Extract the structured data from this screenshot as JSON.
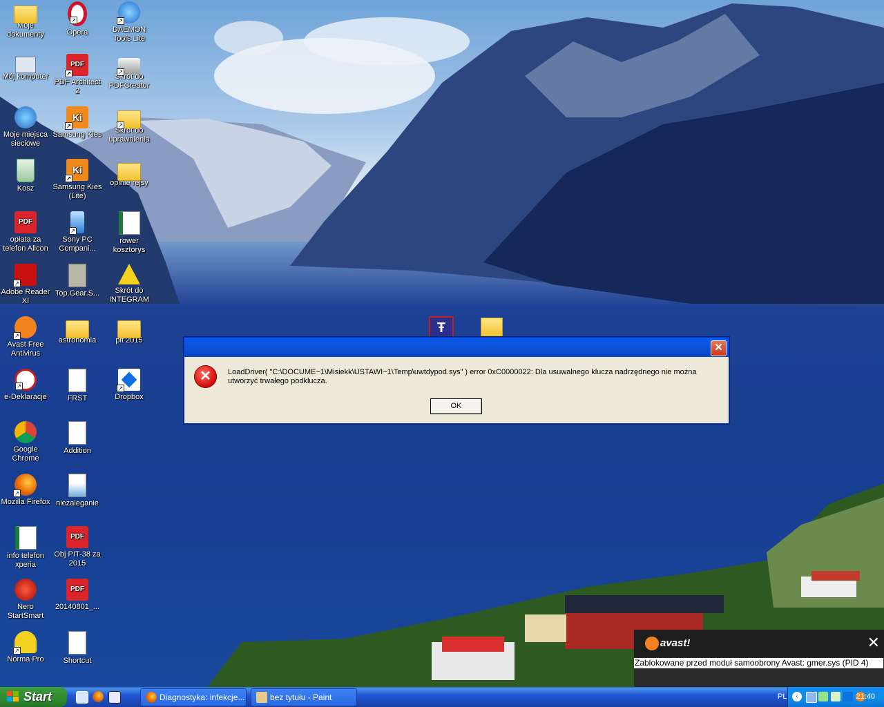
{
  "desktop": {
    "icons": [
      {
        "label": "Moje dokumenty",
        "icon": "my-documents-icon"
      },
      {
        "label": "Opera",
        "icon": "opera-icon"
      },
      {
        "label": "DAEMON Tools Lite",
        "icon": "daemon-tools-icon"
      },
      {
        "label": "Mój komputer",
        "icon": "my-computer-icon"
      },
      {
        "label": "PDF Architect 2",
        "icon": "pdf-architect-icon"
      },
      {
        "label": "Skrót do PDFCreator",
        "icon": "printer-icon"
      },
      {
        "label": "Moje miejsca sieciowe",
        "icon": "network-places-icon"
      },
      {
        "label": "Samsung Kies",
        "icon": "samsung-kies-icon"
      },
      {
        "label": "Skrót do uprawnienia",
        "icon": "folder-shortcut-icon"
      },
      {
        "label": "Kosz",
        "icon": "recycle-bin-icon"
      },
      {
        "label": "Samsung Kies (Lite)",
        "icon": "samsung-kies-lite-icon"
      },
      {
        "label": "opinie rejsy",
        "icon": "folder-icon"
      },
      {
        "label": "opłata za telefon Allcon",
        "icon": "pdf-file-icon"
      },
      {
        "label": "Sony PC Compani...",
        "icon": "sony-pc-companion-icon"
      },
      {
        "label": "rower kosztorys",
        "icon": "excel-file-icon"
      },
      {
        "label": "Adobe Reader XI",
        "icon": "adobe-reader-icon"
      },
      {
        "label": "Top.Gear.S...",
        "icon": "video-file-icon"
      },
      {
        "label": "Skrót do INTEGRAM",
        "icon": "integram-icon"
      },
      {
        "label": "Avast Free Antivirus",
        "icon": "avast-icon"
      },
      {
        "label": "astronomia",
        "icon": "folder-icon"
      },
      {
        "label": "pit 2015",
        "icon": "folder-icon"
      },
      {
        "label": "e-Deklaracje",
        "icon": "e-deklaracje-icon"
      },
      {
        "label": "FRST",
        "icon": "text-file-icon"
      },
      {
        "label": "Dropbox",
        "icon": "dropbox-icon"
      },
      {
        "label": "Google Chrome",
        "icon": "chrome-icon"
      },
      {
        "label": "Addition",
        "icon": "text-file-icon"
      },
      {
        "label": "Mozilla Firefox",
        "icon": "firefox-icon"
      },
      {
        "label": "niezaleganie",
        "icon": "image-file-icon"
      },
      {
        "label": "info telefon xperia",
        "icon": "excel-file-icon"
      },
      {
        "label": "Obj PIT-38 za 2015",
        "icon": "pdf-file-icon"
      },
      {
        "label": "Nero StartSmart",
        "icon": "nero-icon"
      },
      {
        "label": "20140801_...",
        "icon": "pdf-file-icon"
      },
      {
        "label": "Norma Pro",
        "icon": "norma-pro-icon"
      },
      {
        "label": "Shortcut",
        "icon": "text-file-icon"
      }
    ],
    "floating_icons": [
      "gmer-app-icon",
      "zip-folder-icon"
    ]
  },
  "dialog": {
    "title": "",
    "message": "LoadDriver( \"C:\\DOCUME~1\\Misiekk\\USTAWI~1\\Temp\\uwtdypod.sys\" ) error 0xC0000022: Dla usuwalnego klucza nadrzędnego nie można utworzyć trwałego podklucza.",
    "ok_label": "OK",
    "close_glyph": "✕",
    "error_glyph": "✕"
  },
  "avast_popup": {
    "brand": "avast!",
    "message": "Zablokowane przed moduł samoobrony Avast: gmer.sys (PID 4)",
    "close_glyph": "✕"
  },
  "taskbar": {
    "start_label": "Start",
    "quick_launch": [
      "show-desktop-icon",
      "firefox-icon",
      "save-icon"
    ],
    "tasks": [
      {
        "label": "Diagnostyka: infekcje...",
        "icon": "firefox-icon"
      },
      {
        "label": "bez tytułu - Paint",
        "icon": "paint-icon"
      }
    ],
    "language": "PL",
    "clock": "21:40",
    "tray_icons": [
      "chevron-left-icon",
      "network-icon",
      "usb-icon",
      "shield-icon",
      "dropbox-icon",
      "avast-icon"
    ]
  },
  "colors": {
    "titlebar": "#0a5ae8",
    "start_button": "#2f8a2f",
    "taskbar": "#2157d7",
    "error_red": "#d10b0b",
    "avast_orange": "#f58220"
  }
}
